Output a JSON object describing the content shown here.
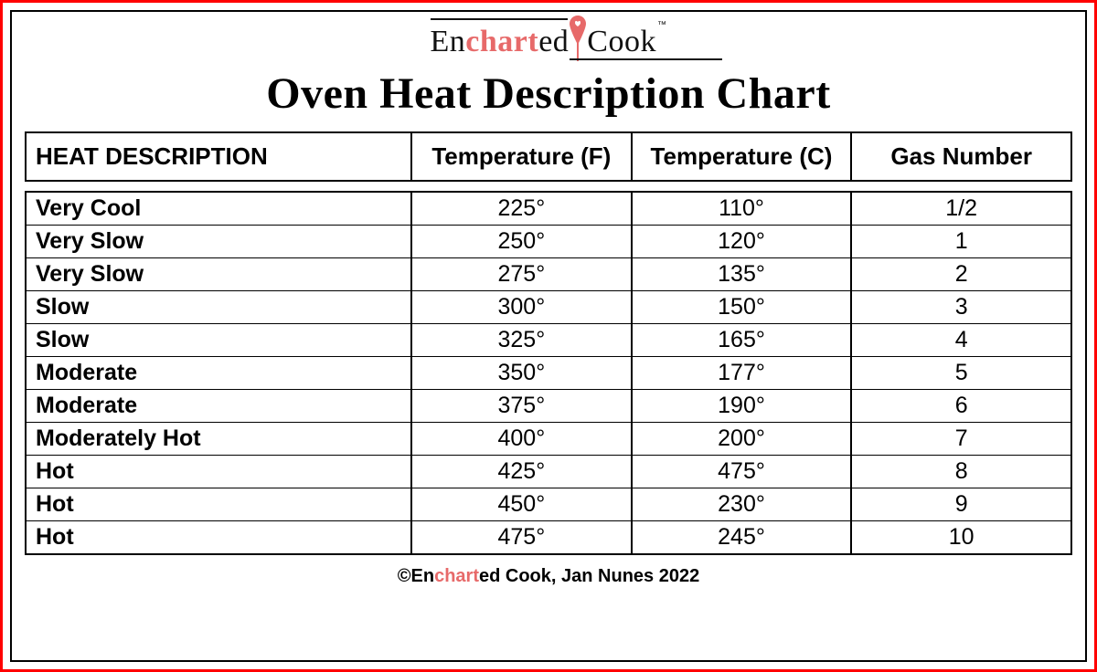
{
  "logo": {
    "en": "En",
    "chart": "chart",
    "ed": "ed",
    "cook": "Cook",
    "tm": "™"
  },
  "title": "Oven Heat Description Chart",
  "chart_data": {
    "type": "table",
    "columns": [
      "HEAT DESCRIPTION",
      "Temperature (F)",
      "Temperature (C)",
      "Gas Number"
    ],
    "rows": [
      {
        "desc": "Very Cool",
        "f": "225°",
        "c": "110°",
        "gas": "1/2"
      },
      {
        "desc": "Very Slow",
        "f": "250°",
        "c": "120°",
        "gas": "1"
      },
      {
        "desc": "Very Slow",
        "f": "275°",
        "c": "135°",
        "gas": "2"
      },
      {
        "desc": "Slow",
        "f": "300°",
        "c": "150°",
        "gas": "3"
      },
      {
        "desc": "Slow",
        "f": "325°",
        "c": "165°",
        "gas": "4"
      },
      {
        "desc": "Moderate",
        "f": "350°",
        "c": "177°",
        "gas": "5"
      },
      {
        "desc": "Moderate",
        "f": "375°",
        "c": "190°",
        "gas": "6"
      },
      {
        "desc": "Moderately Hot",
        "f": "400°",
        "c": "200°",
        "gas": "7"
      },
      {
        "desc": "Hot",
        "f": "425°",
        "c": "475°",
        "gas": "8"
      },
      {
        "desc": "Hot",
        "f": "450°",
        "c": "230°",
        "gas": "9"
      },
      {
        "desc": "Hot",
        "f": "475°",
        "c": "245°",
        "gas": "10"
      }
    ]
  },
  "footer": {
    "prefix": "©En",
    "chart": "chart",
    "suffix": "ed Cook, Jan Nunes 2022"
  }
}
